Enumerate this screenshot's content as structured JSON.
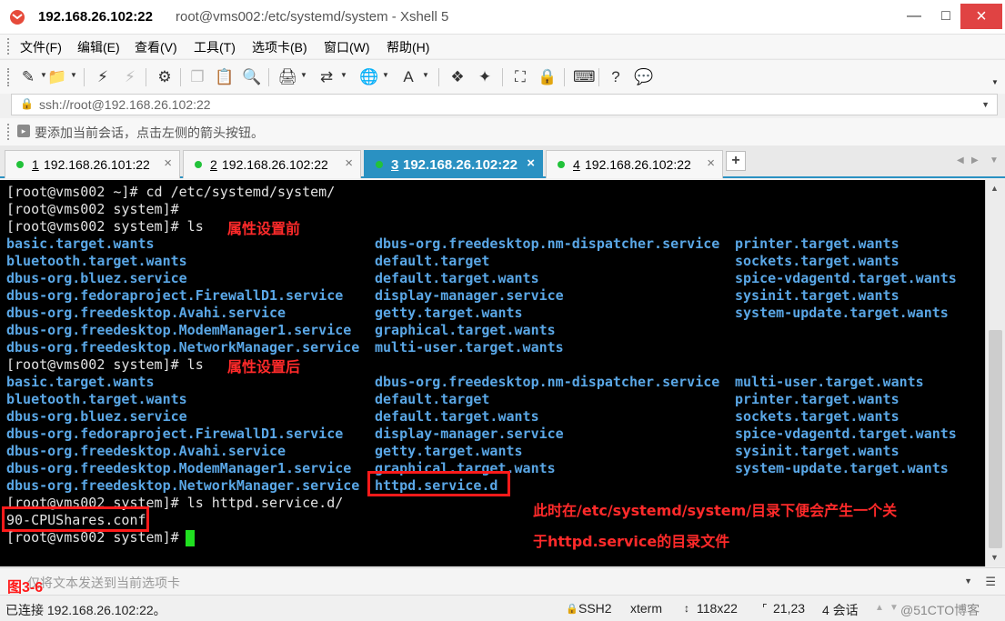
{
  "window": {
    "title_host": "192.168.26.102:22",
    "title_rest": "root@vms002:/etc/systemd/system - Xshell 5"
  },
  "menu": [
    "文件(F)",
    "编辑(E)",
    "查看(V)",
    "工具(T)",
    "选项卡(B)",
    "窗口(W)",
    "帮助(H)"
  ],
  "address": {
    "value": "ssh://root@192.168.26.102:22"
  },
  "hint": "要添加当前会话，点击左侧的箭头按钮。",
  "tabs": [
    {
      "num": "1",
      "label": "192.168.26.101:22",
      "active": false
    },
    {
      "num": "2",
      "label": "192.168.26.102:22",
      "active": false
    },
    {
      "num": "3",
      "label": "192.168.26.102:22",
      "active": true
    },
    {
      "num": "4",
      "label": "192.168.26.102:22",
      "active": false
    }
  ],
  "terminal": {
    "lines": [
      "[root@vms002 ~]# cd /etc/systemd/system/",
      "[root@vms002 system]#",
      "[root@vms002 system]# ls",
      "[root@vms002 system]# ls",
      "[root@vms002 system]# ls httpd.service.d/",
      "90-CPUShares.conf",
      "[root@vms002 system]#"
    ],
    "ls_before": {
      "col1": [
        "basic.target.wants",
        "bluetooth.target.wants",
        "dbus-org.bluez.service",
        "dbus-org.fedoraproject.FirewallD1.service",
        "dbus-org.freedesktop.Avahi.service",
        "dbus-org.freedesktop.ModemManager1.service",
        "dbus-org.freedesktop.NetworkManager.service"
      ],
      "col2": [
        "dbus-org.freedesktop.nm-dispatcher.service",
        "default.target",
        "default.target.wants",
        "display-manager.service",
        "getty.target.wants",
        "graphical.target.wants",
        "multi-user.target.wants"
      ],
      "col3": [
        "printer.target.wants",
        "sockets.target.wants",
        "spice-vdagentd.target.wants",
        "sysinit.target.wants",
        "system-update.target.wants"
      ]
    },
    "ls_after": {
      "col1": [
        "basic.target.wants",
        "bluetooth.target.wants",
        "dbus-org.bluez.service",
        "dbus-org.fedoraproject.FirewallD1.service",
        "dbus-org.freedesktop.Avahi.service",
        "dbus-org.freedesktop.ModemManager1.service",
        "dbus-org.freedesktop.NetworkManager.service"
      ],
      "col2": [
        "dbus-org.freedesktop.nm-dispatcher.service",
        "default.target",
        "default.target.wants",
        "display-manager.service",
        "getty.target.wants",
        "graphical.target.wants",
        "httpd.service.d"
      ],
      "col3": [
        "multi-user.target.wants",
        "printer.target.wants",
        "sockets.target.wants",
        "spice-vdagentd.target.wants",
        "sysinit.target.wants",
        "system-update.target.wants"
      ]
    },
    "annotations": {
      "before": "属性设置前",
      "after": "属性设置后",
      "note_line1": "此时在/etc/systemd/system/目录下便会产生一个关",
      "note_line2": "于httpd.service的目录文件"
    }
  },
  "send_bar": {
    "placeholder": "仅将文本发送到当前选项卡"
  },
  "figure_label": "图3-6",
  "status": {
    "connected": "已连接 192.168.26.102:22。",
    "protocol": "SSH2",
    "term": "xterm",
    "size": "118x22",
    "cursor": "21,23",
    "sessions": "4 会话",
    "watermark": "@51CTO博客"
  },
  "colors": {
    "terminal_bg": "#000000",
    "dir_blue": "#5aa7e6",
    "prompt_gray": "#e2e2e2",
    "annotation_red": "#ff2a2a",
    "cursor_green": "#20e020",
    "tab_active": "#2a91c2"
  }
}
